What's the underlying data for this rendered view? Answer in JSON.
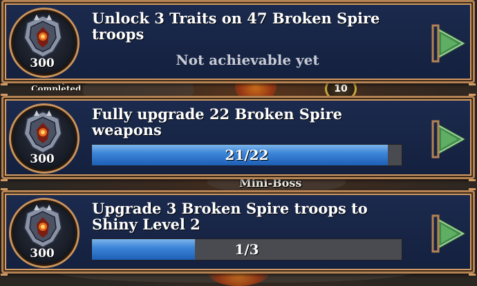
{
  "background": {
    "label_class_quest": "Class Quest - Completed",
    "label_mini_boss": "Mini-Boss",
    "badge_count": "10"
  },
  "colors": {
    "card_bg": "#1b2a4e",
    "card_border": "#d39b63",
    "progress_fill": "#3d86d8",
    "progress_track": "#4a4b50",
    "go_button": "#3f8a4a"
  },
  "quests": [
    {
      "title": "Unlock 3 Traits on 47 Broken Spire troops",
      "reward_icon": "broken-spire-shield-icon",
      "reward": "300",
      "status": "Not achievable yet",
      "go_icon": "green-arrow-right-icon"
    },
    {
      "title": "Fully upgrade 22 Broken Spire weapons",
      "reward_icon": "broken-spire-shield-icon",
      "reward": "300",
      "progress_text": "21/22",
      "progress": 0.955,
      "go_icon": "green-arrow-right-icon"
    },
    {
      "title": "Upgrade 3 Broken Spire troops to Shiny Level 2",
      "reward_icon": "broken-spire-shield-icon",
      "reward": "300",
      "progress_text": "1/3",
      "progress": 0.333,
      "go_icon": "green-arrow-right-icon"
    }
  ]
}
